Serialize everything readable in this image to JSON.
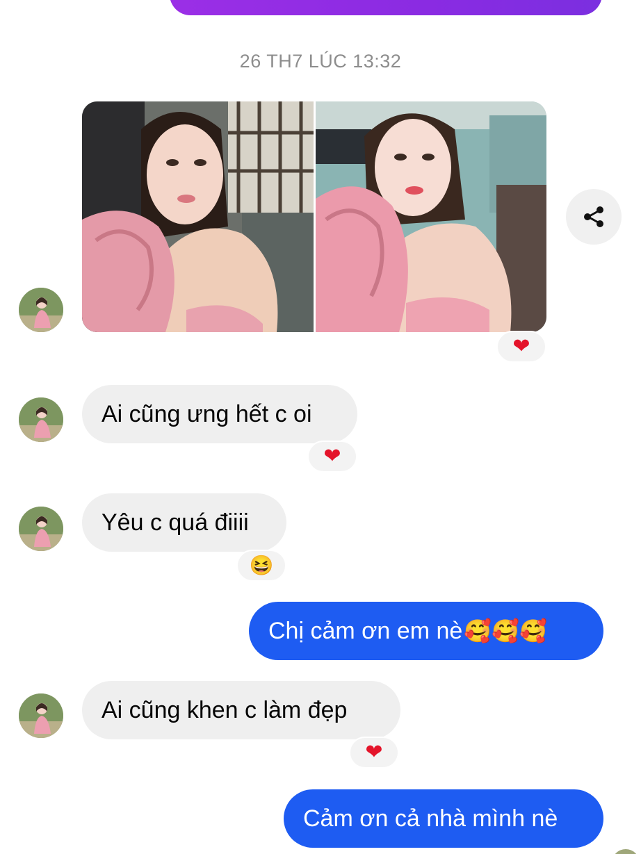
{
  "conversation": {
    "timestamp": "26 TH7 LÚC 13:32",
    "messages": [
      {
        "side": "in",
        "text": "Ai cũng ưng hết c oi",
        "reaction": "heart-icon"
      },
      {
        "side": "in",
        "text": "Yêu c quá điiii",
        "reaction": "laughing-emoji-icon"
      },
      {
        "side": "out",
        "text": "Chị cảm ơn em nè",
        "emoji": "🥰🥰🥰"
      },
      {
        "side": "in",
        "text": "Ai cũng khen c làm đẹp",
        "reaction": "heart-icon"
      },
      {
        "side": "out",
        "text": "Cảm ơn cả nhà mình nè"
      }
    ],
    "photo_reaction": "heart-icon"
  },
  "colors": {
    "outgoing_bubble": "#1e5cf2",
    "incoming_bubble": "#efefef",
    "top_bubble": "#8a2be2",
    "heart": "#e4142a",
    "timestamp_text": "#8d8d8d"
  },
  "reaction_glyphs": {
    "heart": "❤",
    "laugh": "😆"
  }
}
